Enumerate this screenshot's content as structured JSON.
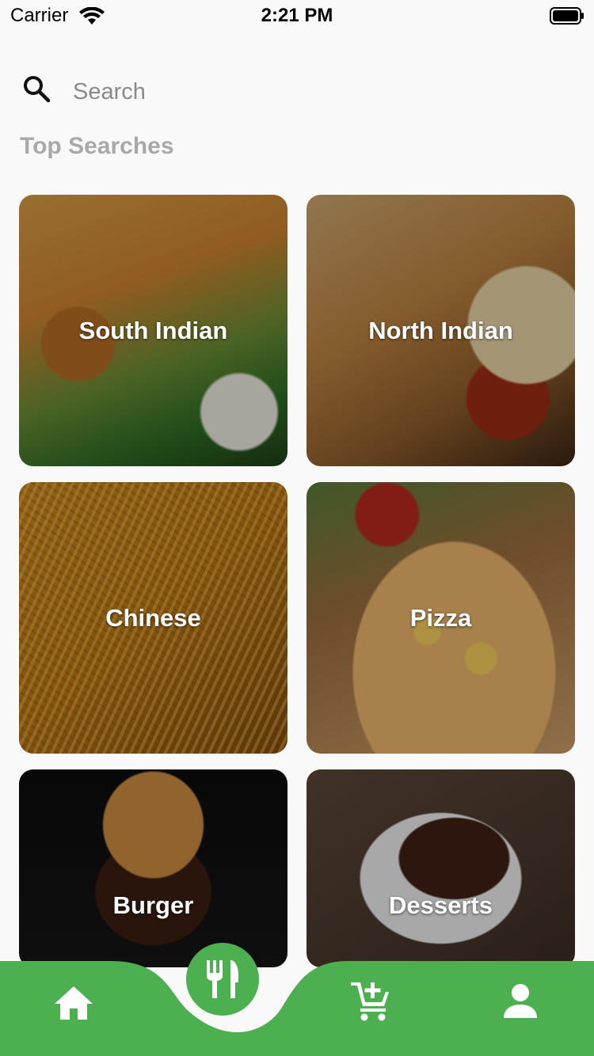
{
  "status_bar": {
    "carrier": "Carrier",
    "time": "2:21 PM"
  },
  "search": {
    "placeholder": "Search",
    "value": ""
  },
  "section_title": "Top Searches",
  "categories": [
    {
      "label": "South Indian"
    },
    {
      "label": "North Indian"
    },
    {
      "label": "Chinese"
    },
    {
      "label": "Pizza"
    },
    {
      "label": "Burger"
    },
    {
      "label": "Desserts"
    }
  ],
  "bottom_nav": {
    "items": [
      {
        "icon": "home-icon"
      },
      {
        "icon": "restaurant-icon",
        "selected": true
      },
      {
        "icon": "add-cart-icon"
      },
      {
        "icon": "profile-icon"
      }
    ],
    "color": "#4caf50"
  }
}
